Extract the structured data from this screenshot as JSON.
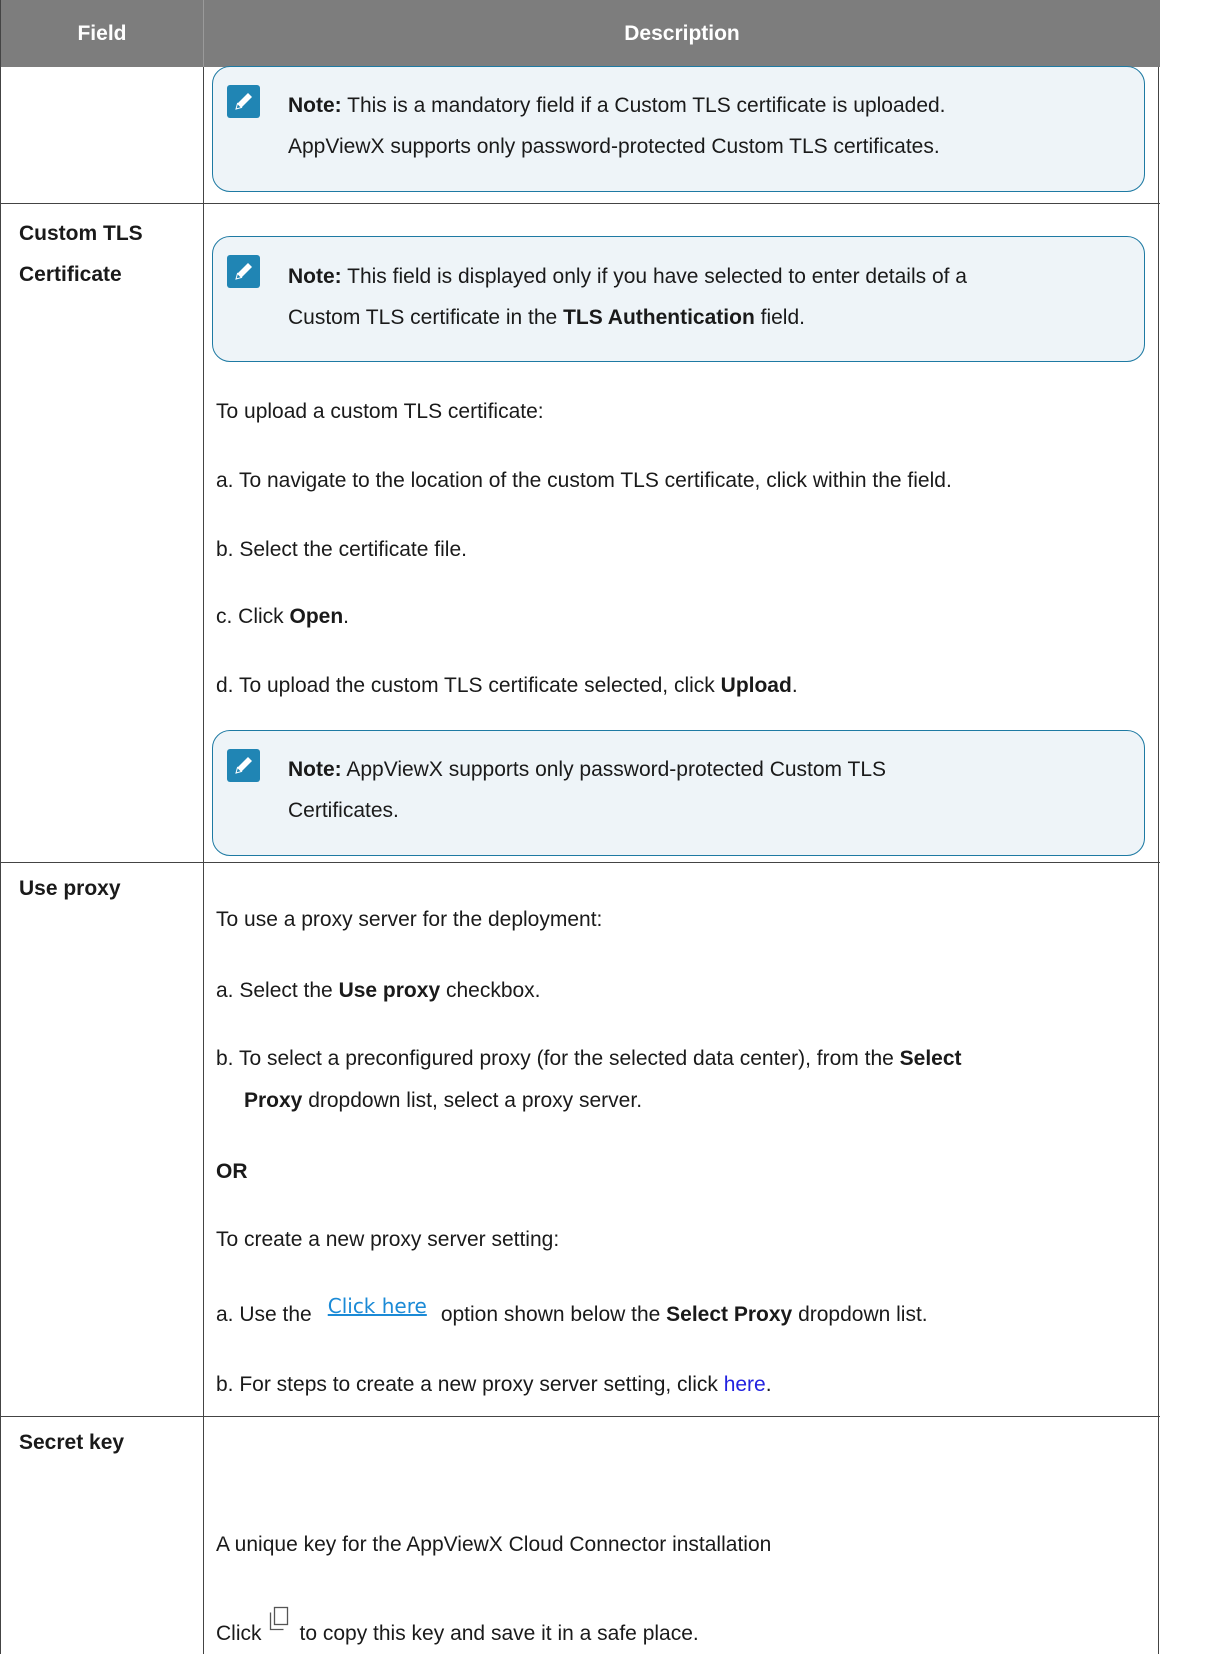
{
  "header": {
    "field": "Field",
    "description": "Description"
  },
  "rows": {
    "password_note": {
      "label": "Note:",
      "text1": " This is a mandatory field if a Custom TLS certificate is uploaded.",
      "text2": "AppViewX supports only password-protected Custom TLS certificates."
    },
    "custom_tls": {
      "field_line1": "Custom TLS",
      "field_line2": "Certificate",
      "note1": {
        "label": "Note:",
        "text1": " This field is displayed only if you have selected to enter details of a",
        "text2a": "Custom TLS certificate in the ",
        "text2b": "TLS Authentication",
        "text2c": " field."
      },
      "intro": "To upload a custom TLS certificate:",
      "step_a": "a. To navigate to the location of the custom TLS certificate, click within the field.",
      "step_b": "b. Select the certificate file.",
      "step_c_pre": "c. Click ",
      "step_c_bold": "Open",
      "step_c_post": ".",
      "step_d_pre": "d. To upload the custom TLS certificate selected, click ",
      "step_d_bold": "Upload",
      "step_d_post": ".",
      "note2": {
        "label": "Note:",
        "text1": " AppViewX supports only password-protected Custom TLS",
        "text2": "Certificates."
      }
    },
    "use_proxy": {
      "field": "Use proxy",
      "intro": "To use a proxy server for the deployment:",
      "step_a_pre": "a. Select the ",
      "step_a_bold": "Use proxy",
      "step_a_post": " checkbox.",
      "step_b_pre": "b. To select a preconfigured proxy (for the selected data center), from the ",
      "step_b_bold1": "Select",
      "step_b_bold2": "Proxy",
      "step_b_post": " dropdown list, select a proxy server.",
      "or": "OR",
      "intro2": "To create a new proxy server setting:",
      "step2_a_pre": "a. Use the",
      "step2_a_link": "Click here",
      "step2_a_mid": "option shown below the ",
      "step2_a_bold": "Select Proxy",
      "step2_a_post": " dropdown list.",
      "step2_b_pre": "b. For steps to create a new proxy server setting, click ",
      "step2_b_link": "here",
      "step2_b_post": "."
    },
    "secret_key": {
      "field": "Secret key",
      "desc": "A unique key for the AppViewX Cloud Connector installation",
      "copy_pre": "Click",
      "copy_icon": "copy-icon",
      "copy_post": "to copy this key and save it in a safe place."
    }
  },
  "colors": {
    "header_bg": "#7d7d7d",
    "note_bg": "#eef4f8",
    "note_border": "#1e7aa3",
    "note_icon": "#2085b4",
    "link": "#2222e0"
  }
}
